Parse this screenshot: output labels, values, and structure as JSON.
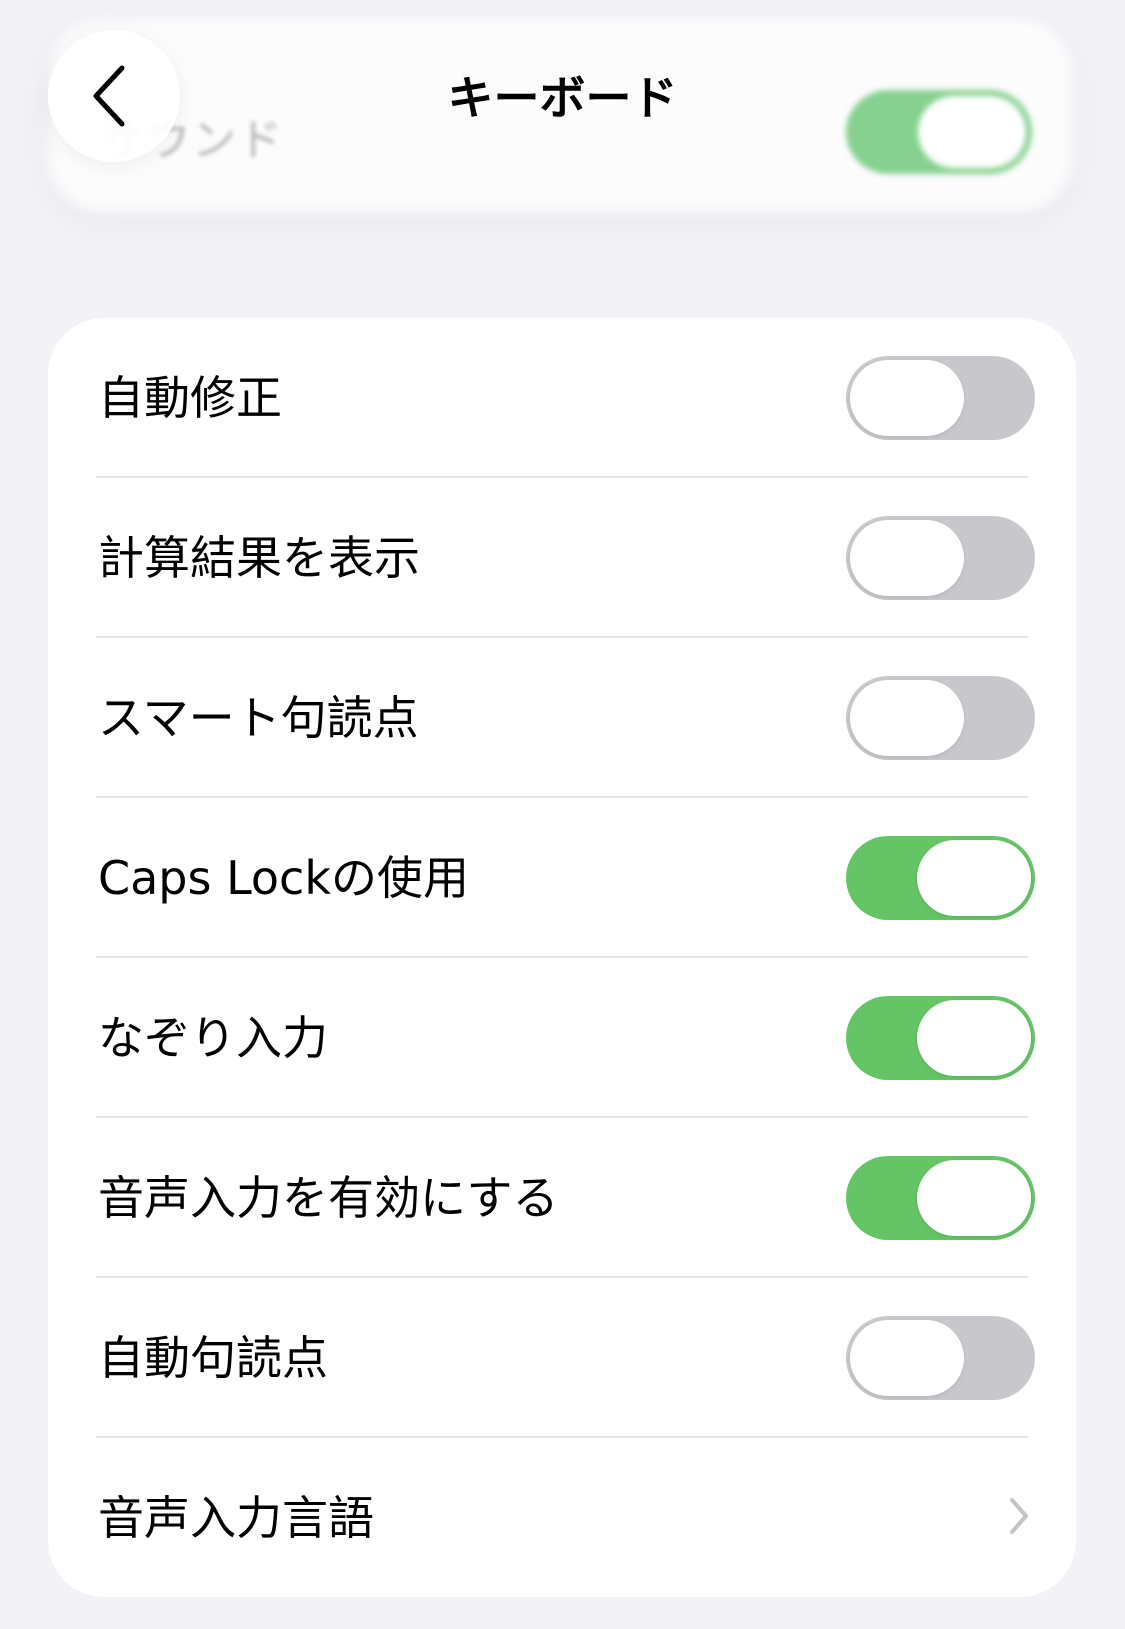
{
  "nav": {
    "title": "キーボード",
    "back_icon": "chevron-left-icon"
  },
  "peek": {
    "label": "サウンド",
    "toggle_state": "on"
  },
  "settings": {
    "rows": [
      {
        "label": "自動修正",
        "control": "toggle",
        "state": "off"
      },
      {
        "label": "計算結果を表示",
        "control": "toggle",
        "state": "off"
      },
      {
        "label": "スマート句読点",
        "control": "toggle",
        "state": "off"
      },
      {
        "label": "Caps Lockの使用",
        "control": "toggle",
        "state": "on"
      },
      {
        "label": "なぞり入力",
        "control": "toggle",
        "state": "on"
      },
      {
        "label": "音声入力を有効にする",
        "control": "toggle",
        "state": "on"
      },
      {
        "label": "自動句読点",
        "control": "toggle",
        "state": "off"
      },
      {
        "label": "音声入力言語",
        "control": "disclosure",
        "icon": "chevron-right-icon"
      }
    ]
  },
  "colors": {
    "background": "#f2f2f7",
    "card": "#ffffff",
    "toggle_on": "#65c466",
    "toggle_off": "#c8c8cc",
    "separator": "#e5e5ea",
    "chevron": "#c4c4c7"
  }
}
